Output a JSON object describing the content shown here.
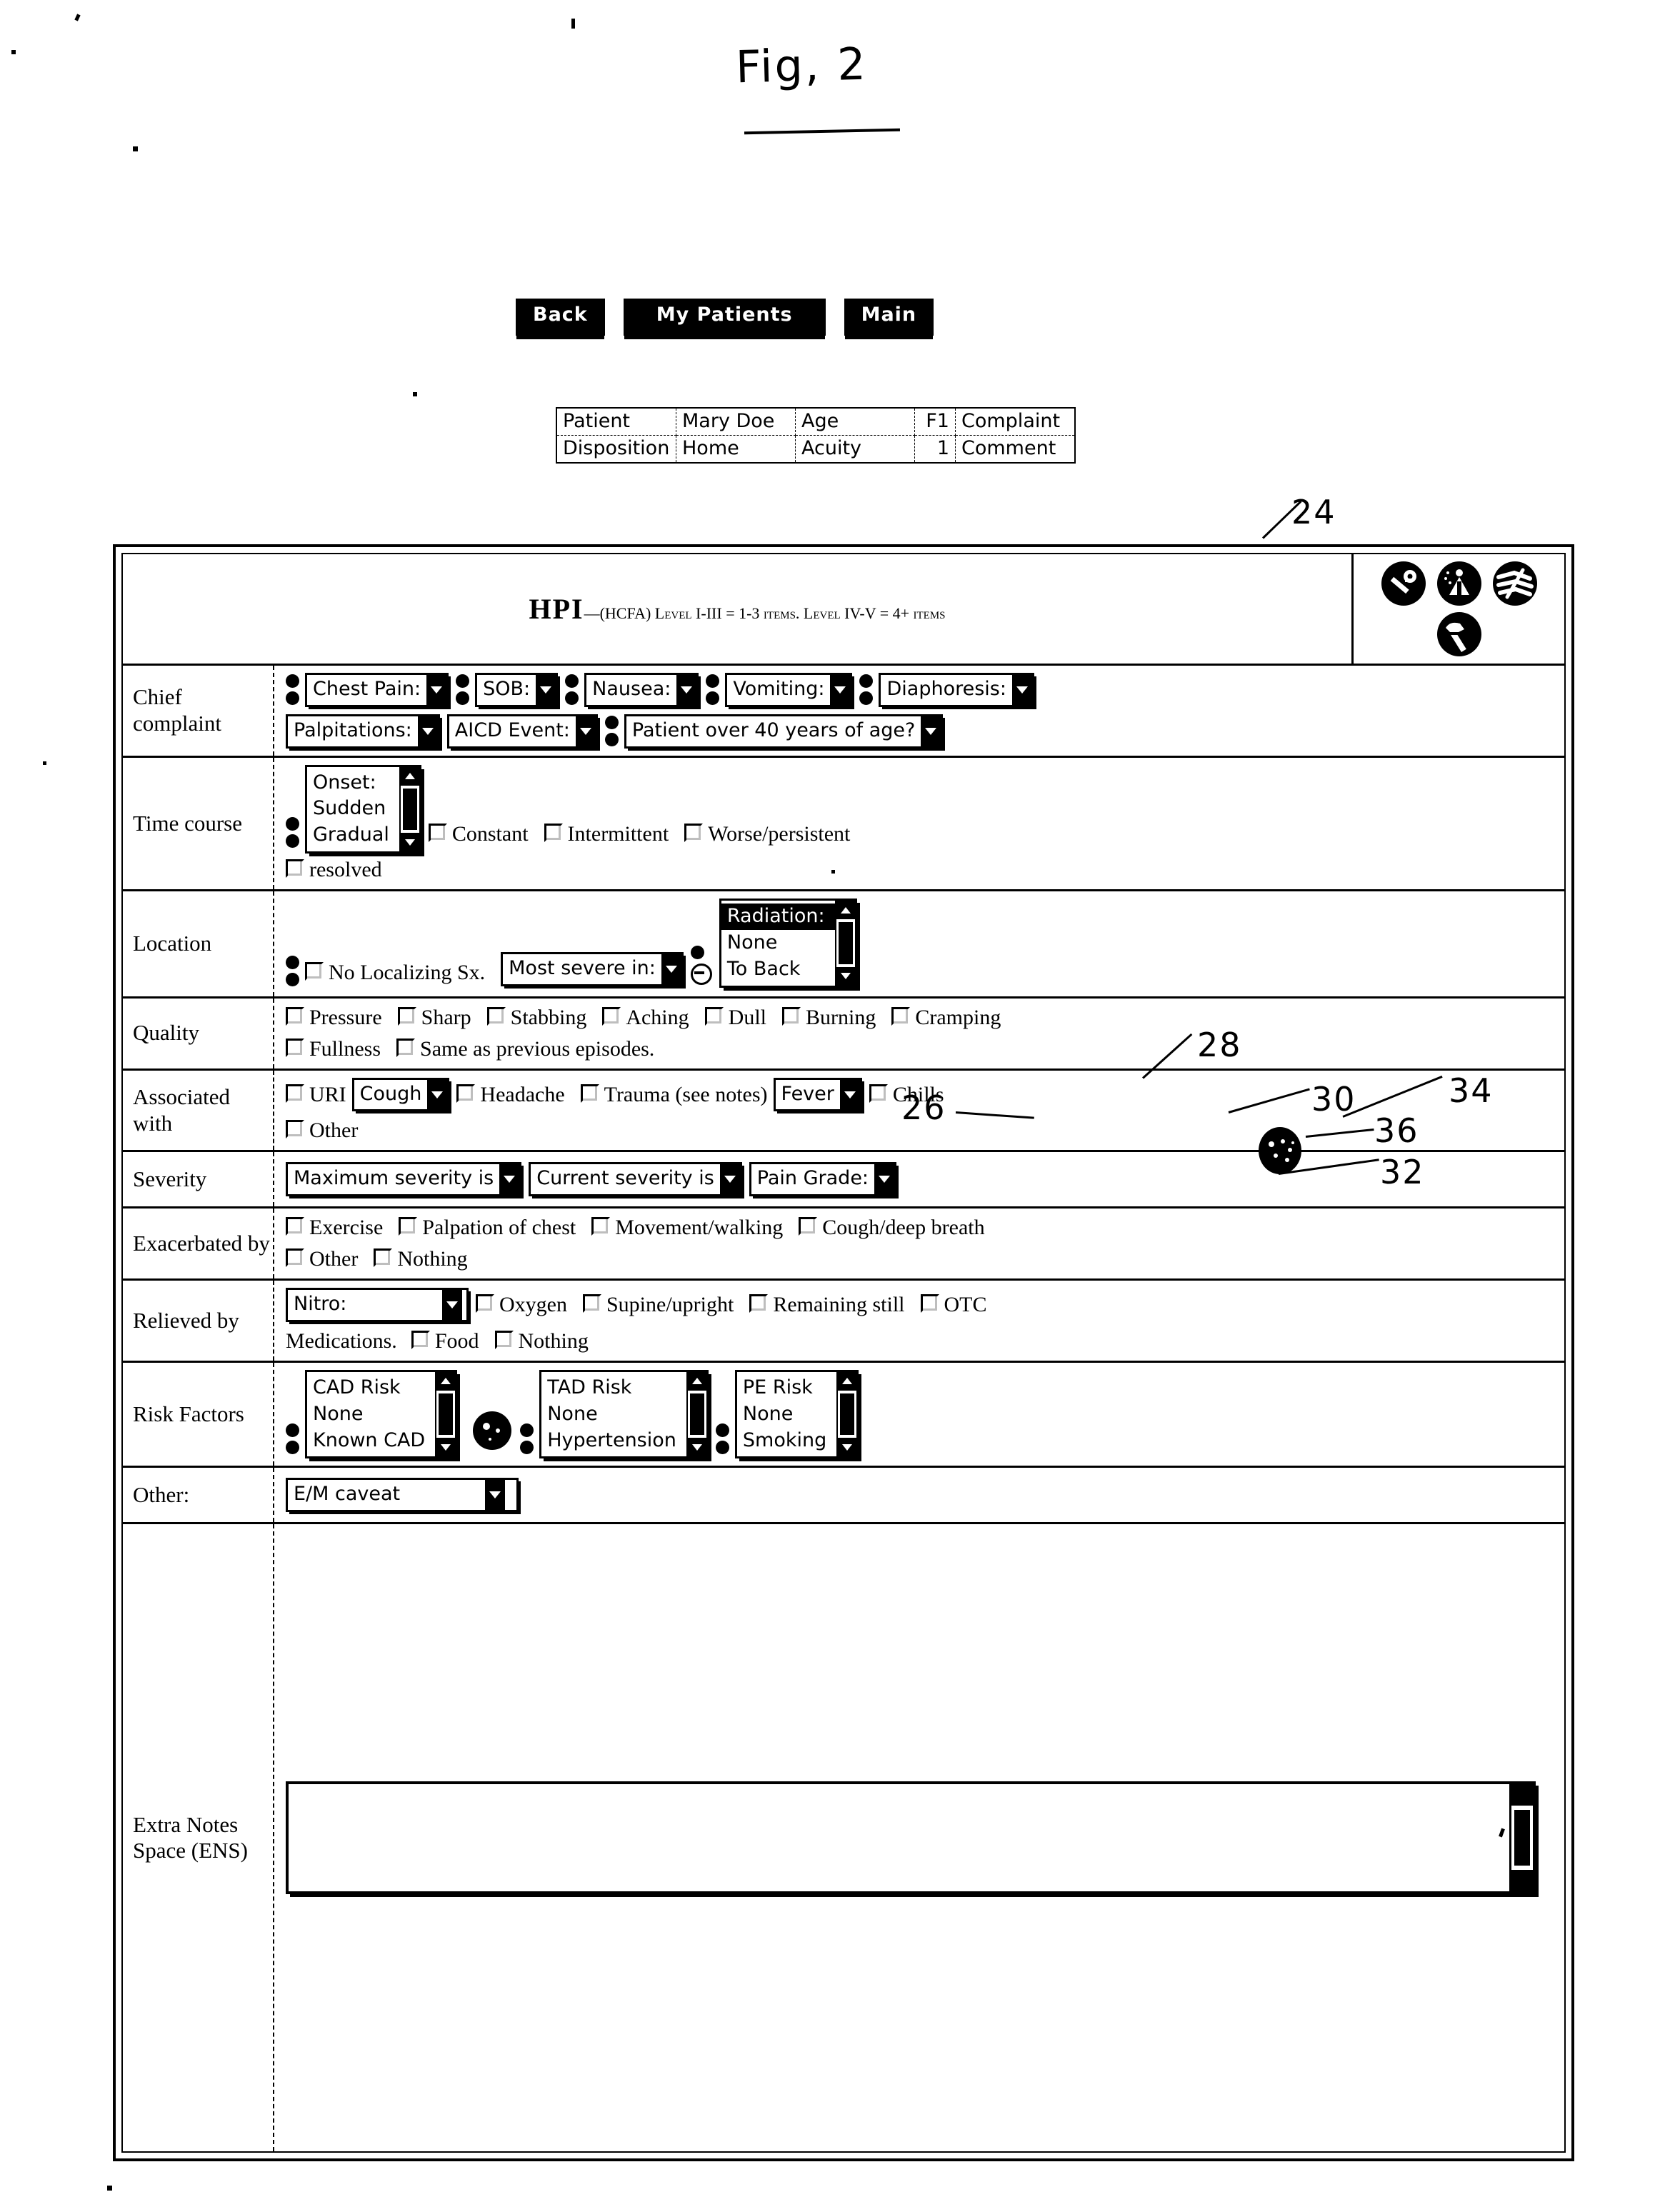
{
  "figure": {
    "title": "Fig, 2",
    "reference_numerals": [
      {
        "id": "24",
        "label": "24"
      },
      {
        "id": "26",
        "label": "26"
      },
      {
        "id": "28",
        "label": "28"
      },
      {
        "id": "30",
        "label": "30"
      },
      {
        "id": "32",
        "label": "32"
      },
      {
        "id": "34",
        "label": "34"
      },
      {
        "id": "36",
        "label": "36"
      }
    ]
  },
  "toolbar": {
    "buttons": [
      {
        "name": "back",
        "label": "Back"
      },
      {
        "name": "my-patients",
        "label": "My Patients"
      },
      {
        "name": "main",
        "label": "Main"
      }
    ]
  },
  "patient_bar": {
    "rows": [
      {
        "label_1": "Patient",
        "value_1": "Mary Doe",
        "label_2": "Age",
        "value_2": "F1",
        "label_3": "Complaint"
      },
      {
        "label_1": "Disposition",
        "value_1": "Home",
        "label_2": "Acuity",
        "value_2": "1",
        "label_3": "Comment"
      }
    ]
  },
  "header": {
    "title_main": "HPI",
    "title_sub": "—(HCFA) Level I-III = 1-3 items. Level IV-V = 4+ items",
    "icons": [
      {
        "name": "key-icon"
      },
      {
        "name": "alert-person-icon"
      },
      {
        "name": "waves-icon"
      },
      {
        "name": "hammer-icon"
      }
    ]
  },
  "rows": {
    "chief_complaint": {
      "label": "Chief complaint",
      "line1": [
        {
          "label": "Chest Pain:"
        },
        {
          "label": "SOB:"
        },
        {
          "label": "Nausea:"
        },
        {
          "label": "Vomiting:"
        },
        {
          "label": "Diaphoresis:"
        }
      ],
      "line2": [
        {
          "label": "Palpitations:"
        },
        {
          "label": "AICD Event:"
        },
        {
          "label": "Patient over 40 years of age?"
        }
      ]
    },
    "time_course": {
      "label": "Time course",
      "listbox": {
        "items": [
          "Onset:",
          "Sudden",
          "Gradual"
        ],
        "selected_index": -1
      },
      "checkboxes": [
        "Constant",
        "Intermittent",
        "Worse/persistent"
      ],
      "checkboxes2": [
        "resolved"
      ]
    },
    "location": {
      "label": "Location",
      "checkbox": "No Localizing Sx.",
      "field": "Most severe in:",
      "listbox": {
        "items": [
          "Radiation:",
          "None",
          "To Back"
        ],
        "selected_index": 0
      }
    },
    "quality": {
      "label": "Quality",
      "line1": [
        "Pressure",
        "Sharp",
        "Stabbing",
        "Aching",
        "Dull",
        "Burning",
        "Cramping"
      ],
      "line2": [
        "Fullness",
        "Same as previous episodes."
      ]
    },
    "associated_with": {
      "label": "Associated with",
      "items_a": [
        "URI"
      ],
      "dropdown_a": "Cough",
      "items_b": [
        "Headache",
        "Trauma (see notes)"
      ],
      "dropdown_b": "Fever",
      "items_c": [
        "Chills"
      ],
      "line2": [
        "Other"
      ]
    },
    "severity": {
      "label": "Severity",
      "fields": [
        "Maximum severity is",
        "Current severity is",
        "Pain Grade:"
      ]
    },
    "exacerbated_by": {
      "label": "Exacerbated by",
      "line1": [
        "Exercise",
        "Palpation of chest",
        "Movement/walking",
        "Cough/deep breath"
      ],
      "line2": [
        "Other",
        "Nothing"
      ]
    },
    "relieved_by": {
      "label": "Relieved by",
      "dropdown": "Nitro:",
      "line1": [
        "Oxygen",
        "Supine/upright",
        "Remaining still",
        "OTC"
      ],
      "line2_prefix": "Medications.",
      "line2": [
        "Food",
        "Nothing"
      ]
    },
    "risk_factors": {
      "label": "Risk Factors",
      "lists": [
        {
          "items": [
            "CAD Risk",
            "None",
            "Known CAD"
          ]
        },
        {
          "items": [
            "TAD Risk",
            "None",
            "Hypertension"
          ]
        },
        {
          "items": [
            "PE Risk",
            "None",
            "Smoking"
          ]
        }
      ]
    },
    "other": {
      "label": "Other:",
      "dropdown": "E/M caveat"
    },
    "extra_notes": {
      "label": "Extra Notes Space (ENS)",
      "value": ""
    }
  }
}
